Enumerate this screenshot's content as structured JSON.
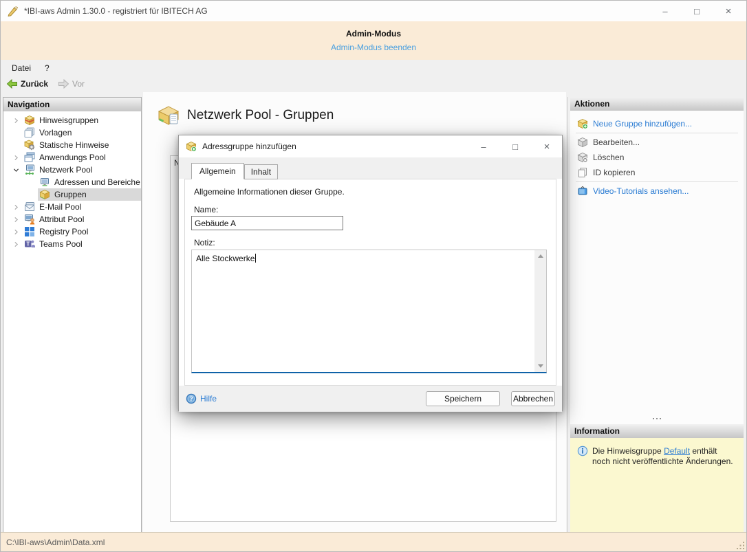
{
  "window": {
    "title": "*IBI-aws Admin 1.30.0 - registriert für IBITECH AG"
  },
  "icons": {
    "minimize": "–",
    "maximize": "□",
    "close": "×"
  },
  "admin_banner": {
    "title": "Admin-Modus",
    "link": "Admin-Modus beenden"
  },
  "menubar": {
    "items": [
      {
        "label": "Datei"
      },
      {
        "label": "?"
      }
    ]
  },
  "toolbar": {
    "back_label": "Zurück",
    "forward_label": "Vor"
  },
  "navigation": {
    "header": "Navigation",
    "items": [
      {
        "label": "Hinweisgruppen",
        "icon": "notice-groups-box-icon",
        "expanded": false,
        "level": 0,
        "selected": false
      },
      {
        "label": "Vorlagen",
        "icon": "templates-stack-icon",
        "level": 0,
        "selected": false
      },
      {
        "label": "Statische Hinweise",
        "icon": "static-notes-gear-icon",
        "level": 0,
        "selected": false
      },
      {
        "label": "Anwendungs Pool",
        "icon": "application-windows-icon",
        "expanded": false,
        "level": 0,
        "selected": false
      },
      {
        "label": "Netzwerk Pool",
        "icon": "network-monitor-icon",
        "expanded": true,
        "level": 0,
        "selected": false
      },
      {
        "label": "Adressen und Bereiche",
        "icon": "addresses-monitor-icon",
        "level": 1,
        "selected": false
      },
      {
        "label": "Gruppen",
        "icon": "groups-box-icon",
        "level": 1,
        "selected": true
      },
      {
        "label": "E-Mail Pool",
        "icon": "email-envelope-icon",
        "expanded": false,
        "level": 0,
        "selected": false
      },
      {
        "label": "Attribut Pool",
        "icon": "attribute-user-monitor-icon",
        "expanded": false,
        "level": 0,
        "selected": false
      },
      {
        "label": "Registry Pool",
        "icon": "registry-blocks-icon",
        "expanded": false,
        "level": 0,
        "selected": false
      },
      {
        "label": "Teams Pool",
        "icon": "teams-icon",
        "expanded": false,
        "level": 0,
        "selected": false
      }
    ]
  },
  "main": {
    "title": "Netzwerk Pool - Gruppen",
    "column_header_partial": "N"
  },
  "actions": {
    "header": "Aktionen",
    "items": [
      {
        "label": "Neue Gruppe hinzufügen...",
        "type": "link",
        "icon": "box-add-icon"
      },
      {
        "label": "Bearbeiten...",
        "type": "disabled",
        "icon": "box-edit-icon"
      },
      {
        "label": "Löschen",
        "type": "disabled",
        "icon": "box-delete-icon"
      },
      {
        "label": "ID kopieren",
        "type": "disabled",
        "icon": "copy-pages-icon"
      },
      {
        "label": "Video-Tutorials ansehen...",
        "type": "link",
        "icon": "video-tv-icon"
      }
    ]
  },
  "information": {
    "header": "Information",
    "text_before": "Die Hinweisgruppe ",
    "link_text": "Default",
    "text_after": " enthält noch nicht veröffentlichte Änderungen."
  },
  "dialog": {
    "title": "Adressgruppe hinzufügen",
    "tabs": [
      {
        "label": "Allgemein",
        "active": true
      },
      {
        "label": "Inhalt",
        "active": false
      }
    ],
    "description": "Allgemeine Informationen dieser Gruppe.",
    "name_label": "Name:",
    "name_value": "Gebäude A",
    "note_label": "Notiz:",
    "note_value": "Alle Stockwerke",
    "help_label": "Hilfe",
    "save_button": "Speichern",
    "cancel_button": "Abbrechen"
  },
  "statusbar": {
    "path": "C:\\IBI-aws\\Admin\\Data.xml"
  },
  "colors": {
    "banner_bg": "#faebd7",
    "link_blue": "#2b7cd3",
    "banner_link_blue": "#4aa0e0",
    "selected_row_bg": "#d9d9d9",
    "info_bg": "#fbf8d0",
    "focus_border_blue": "#0f62a8"
  }
}
